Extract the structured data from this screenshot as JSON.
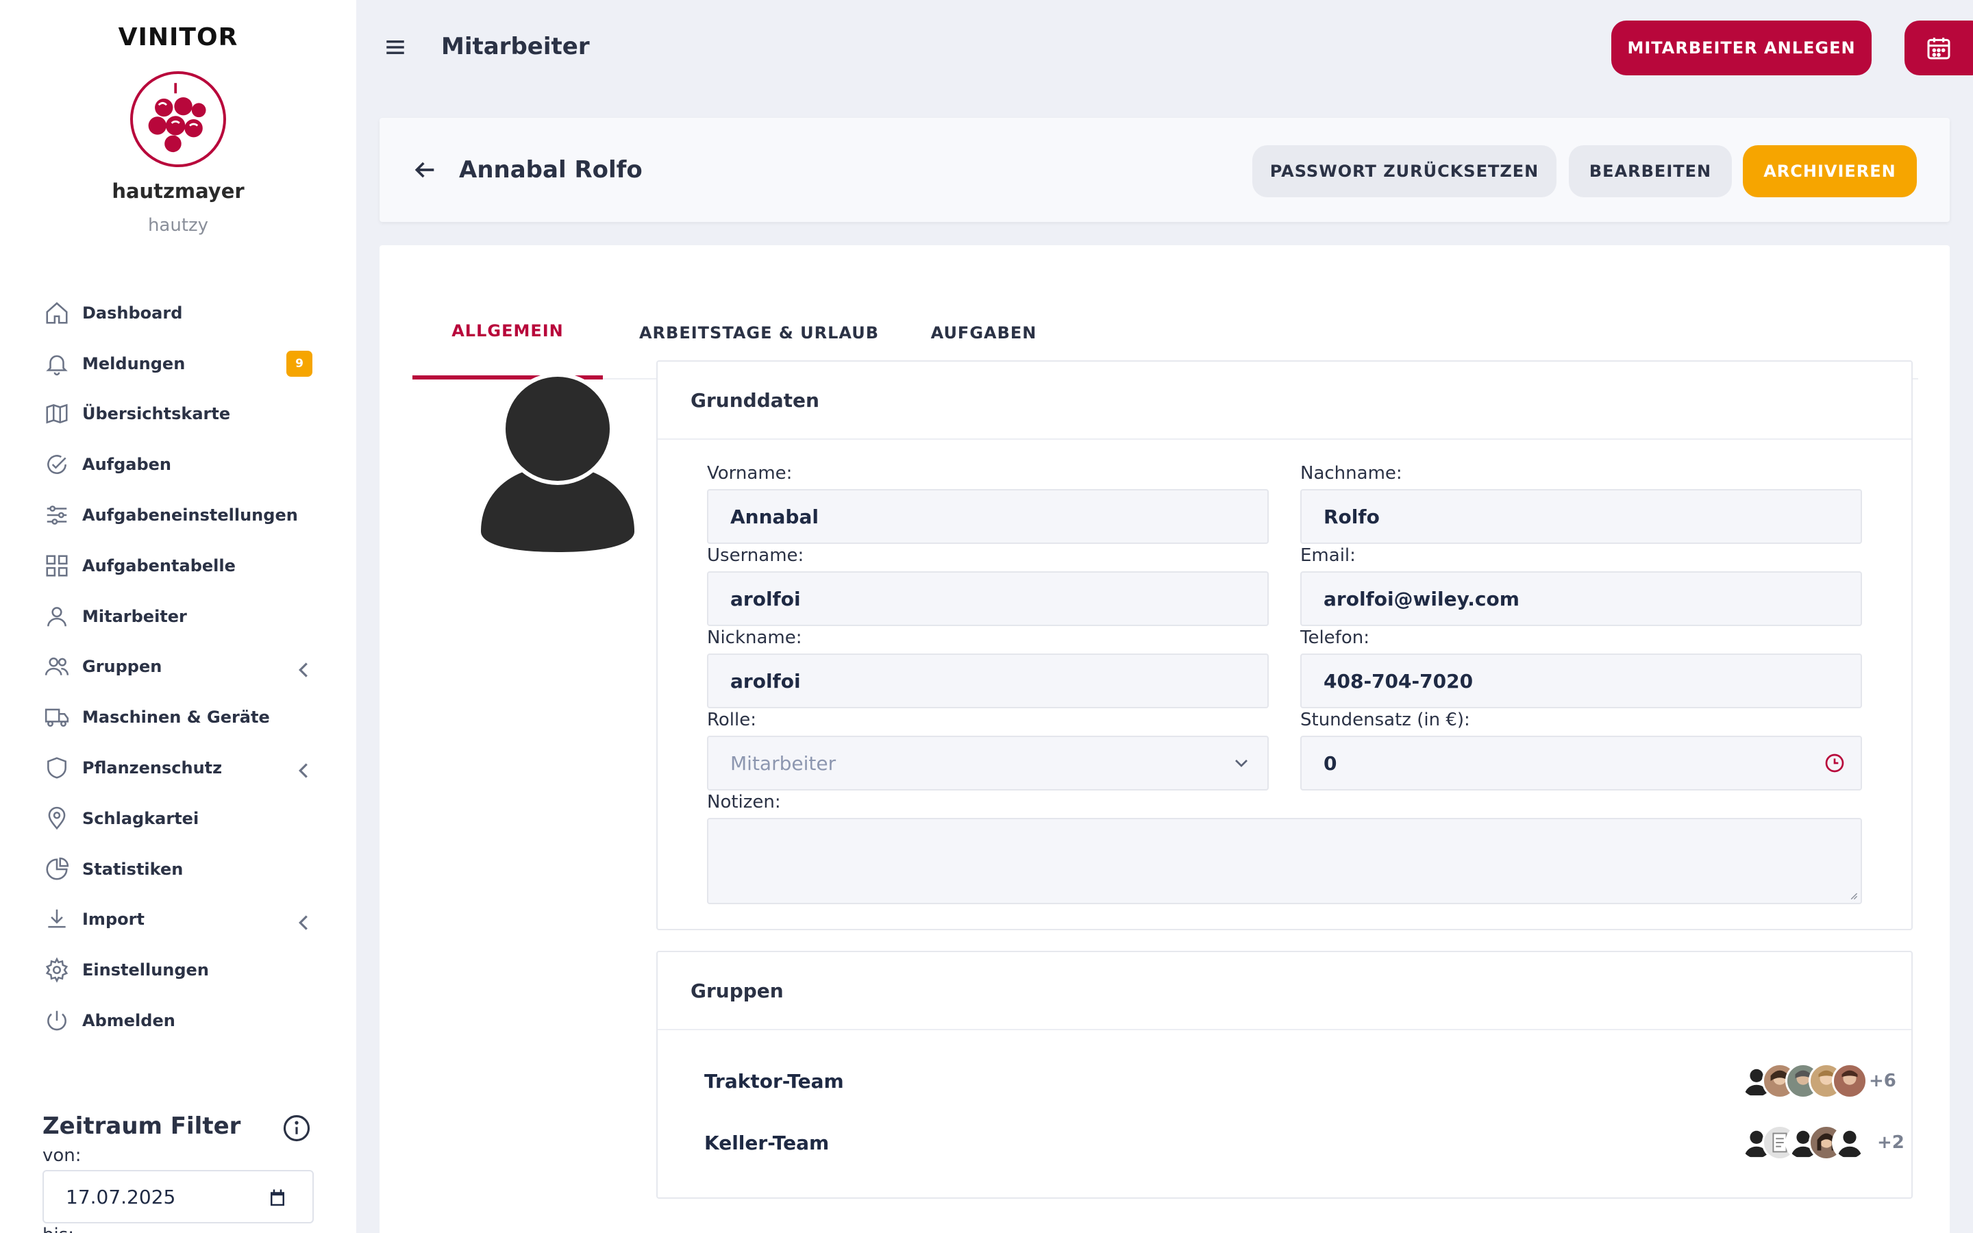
{
  "sidebar": {
    "brand": "VINITOR",
    "user_name": "hautzmayer",
    "user_handle": "hautzy",
    "items": [
      {
        "label": "Dashboard",
        "icon": "home-icon"
      },
      {
        "label": "Meldungen",
        "icon": "bell-icon",
        "badge": "9"
      },
      {
        "label": "Übersichtskarte",
        "icon": "map-icon"
      },
      {
        "label": "Aufgaben",
        "icon": "check-circle-icon"
      },
      {
        "label": "Aufgabeneinstellungen",
        "icon": "sliders-icon"
      },
      {
        "label": "Aufgabentabelle",
        "icon": "grid-icon"
      },
      {
        "label": "Mitarbeiter",
        "icon": "user-icon"
      },
      {
        "label": "Gruppen",
        "icon": "users-icon",
        "chevron": true
      },
      {
        "label": "Maschinen & Geräte",
        "icon": "truck-icon"
      },
      {
        "label": "Pflanzenschutz",
        "icon": "shield-icon",
        "chevron": true
      },
      {
        "label": "Schlagkartei",
        "icon": "map-pin-icon"
      },
      {
        "label": "Statistiken",
        "icon": "pie-chart-icon"
      },
      {
        "label": "Import",
        "icon": "download-icon",
        "chevron": true
      },
      {
        "label": "Einstellungen",
        "icon": "gear-icon"
      },
      {
        "label": "Abmelden",
        "icon": "power-icon"
      }
    ],
    "filter": {
      "title": "Zeitraum Filter",
      "von_label": "von:",
      "von_value": "17.07.2025",
      "bis_label": "bis:"
    }
  },
  "header": {
    "title": "Mitarbeiter",
    "create_button": "MITARBEITER ANLEGEN"
  },
  "detail": {
    "name": "Annabal Rolfo",
    "reset_password_button": "PASSWORT ZURÜCKSETZEN",
    "edit_button": "BEARBEITEN",
    "archive_button": "ARCHIVIEREN"
  },
  "tabs": [
    {
      "label": "ALLGEMEIN",
      "active": true
    },
    {
      "label": "ARBEITSTAGE & URLAUB",
      "active": false
    },
    {
      "label": "AUFGABEN",
      "active": false
    }
  ],
  "grunddaten": {
    "title": "Grunddaten",
    "vorname_label": "Vorname:",
    "vorname": "Annabal",
    "nachname_label": "Nachname:",
    "nachname": "Rolfo",
    "username_label": "Username:",
    "username": "arolfoi",
    "email_label": "Email:",
    "email": "arolfoi@wiley.com",
    "nickname_label": "Nickname:",
    "nickname": "arolfoi",
    "telefon_label": "Telefon:",
    "telefon": "408-704-7020",
    "rolle_label": "Rolle:",
    "rolle": "Mitarbeiter",
    "stundensatz_label": "Stundensatz (in €):",
    "stundensatz": "0",
    "notizen_label": "Notizen:",
    "notizen": ""
  },
  "gruppen": {
    "title": "Gruppen",
    "groups": [
      {
        "name": "Traktor-Team",
        "more": "+6"
      },
      {
        "name": "Keller-Team",
        "more": "+2"
      }
    ]
  },
  "colors": {
    "accent": "#b8073b",
    "warning": "#f6a500",
    "background": "#eef0f6"
  }
}
